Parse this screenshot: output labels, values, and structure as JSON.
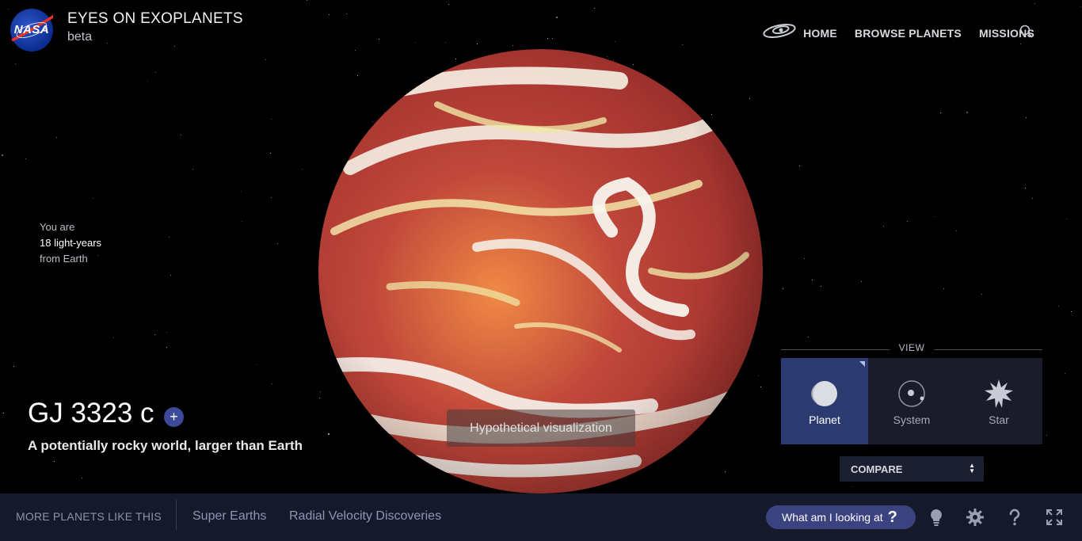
{
  "header": {
    "logo_text": "NASA",
    "title": "EYES ON EXOPLANETS",
    "subtitle": "beta"
  },
  "nav": {
    "home": "HOME",
    "browse": "BROWSE PLANETS",
    "missions": "MISSIONS"
  },
  "distance": {
    "line1": "You are",
    "value": "18 light-years",
    "line3": "from Earth"
  },
  "planet": {
    "name": "GJ 3323 c",
    "tagline": "A potentially rocky world, larger than Earth",
    "visualization_label": "Hypothetical visualization",
    "add_symbol": "+"
  },
  "view": {
    "label": "VIEW",
    "options": [
      {
        "label": "Planet",
        "icon": "planet-icon",
        "active": true
      },
      {
        "label": "System",
        "icon": "system-icon",
        "active": false
      },
      {
        "label": "Star",
        "icon": "star-icon",
        "active": false
      }
    ],
    "compare": "COMPARE"
  },
  "bottom": {
    "more_label": "MORE PLANETS LIKE THIS",
    "categories": [
      "Super Earths",
      "Radial Velocity Discoveries"
    ],
    "help_button": "What am I looking at",
    "help_symbol": "?"
  },
  "colors": {
    "accent": "#2c3a72",
    "bottom_bar": "#161929",
    "pill": "#3a4380"
  }
}
